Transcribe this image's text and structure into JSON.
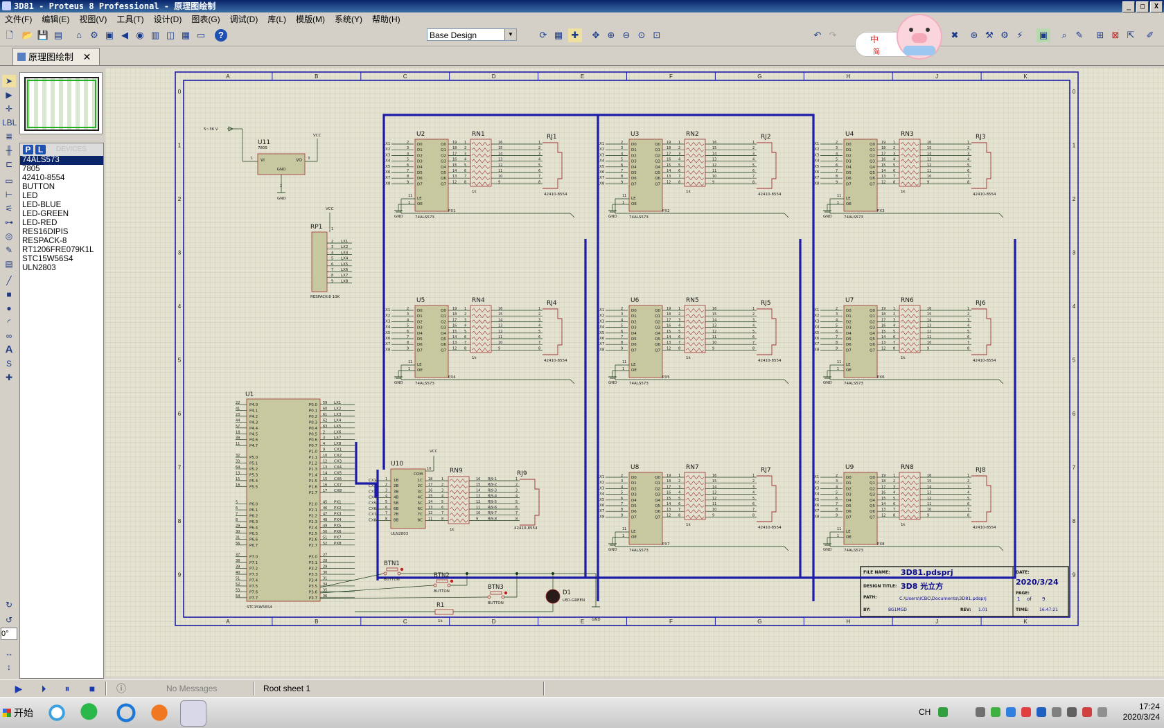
{
  "window": {
    "title": "3D81 - Proteus 8 Professional - 原理图绘制",
    "buttons": [
      "_",
      "□",
      "X"
    ]
  },
  "menu": [
    "文件(F)",
    "编辑(E)",
    "视图(V)",
    "工具(T)",
    "设计(D)",
    "图表(G)",
    "调试(D)",
    "库(L)",
    "模版(M)",
    "系统(Y)",
    "帮助(H)"
  ],
  "toolbar": {
    "design_select": "Base Design",
    "ime_zh": "中",
    "ime_jian": "简"
  },
  "tab": {
    "label": "原理图绘制",
    "close": "✕"
  },
  "device_panel": {
    "p_label": "P",
    "l_label": "L",
    "header": "DEVICES",
    "items": [
      "74ALS573",
      "7805",
      "42410-8554",
      "BUTTON",
      "LED",
      "LED-BLUE",
      "LED-GREEN",
      "LED-RED",
      "RES16DIPIS",
      "RESPACK-8",
      "RT1206FRE079K1L",
      "STC15W56S4",
      "ULN2803"
    ],
    "selected_index": 0
  },
  "rotation": "0°",
  "status": {
    "messages": "No Messages",
    "sheet": "Root sheet 1"
  },
  "sheet": {
    "cols": [
      "A",
      "B",
      "C",
      "D",
      "E",
      "F",
      "G",
      "H",
      "J",
      "K"
    ],
    "rows": [
      "0",
      "1",
      "2",
      "3",
      "4",
      "5",
      "6",
      "7",
      "8",
      "9"
    ],
    "titleblock": {
      "file_label": "FILE NAME:",
      "file": "3D81.pdsprj",
      "date_label": "DATE:",
      "date": "2020/3/24",
      "design_label": "DESIGN TITLE:",
      "design": "3D8 光立方",
      "page_label": "PAGE:",
      "page": "1",
      "of": "of",
      "pages": "9",
      "path_label": "PATH:",
      "path": "C:\\Users\\ICBC\\Documents\\3D81.pdsprj",
      "by_label": "BY:",
      "by": "BG1MGD",
      "rev_label": "REV:",
      "rev": "1.01",
      "time_label": "TIME:",
      "time": "16:47:21"
    },
    "latch_pins_in": [
      "D0",
      "D1",
      "D2",
      "D3",
      "D4",
      "D5",
      "D6",
      "D7"
    ],
    "latch_pins_out": [
      "Q0",
      "Q1",
      "Q2",
      "Q3",
      "Q4",
      "Q5",
      "Q6",
      "Q7"
    ],
    "lx_labels": [
      "LX1",
      "LX2",
      "LX3",
      "LX4",
      "LX5",
      "LX6",
      "LX7",
      "LX8"
    ],
    "latch_pin_nums_in": [
      "2",
      "3",
      "4",
      "5",
      "6",
      "7",
      "8",
      "9"
    ],
    "latch_pin_nums_out": [
      "19",
      "18",
      "17",
      "16",
      "15",
      "14",
      "13",
      "12"
    ],
    "rn_in_nums": [
      "1",
      "2",
      "3",
      "4",
      "5",
      "6",
      "7",
      "8"
    ],
    "rn_out_nums": [
      "16",
      "15",
      "14",
      "13",
      "12",
      "11",
      "10",
      "9"
    ],
    "rj_nums": [
      "1",
      "2",
      "3",
      "4",
      "5",
      "6",
      "7",
      "8"
    ],
    "le_label": "LE",
    "oe_label": "OE",
    "gnd": "GND",
    "vcc": "VCC",
    "latch_part": "74ALS573",
    "rn_value": "1k",
    "rj_part": "42410-8554",
    "pin11": "11",
    "pin1": "1",
    "groups": [
      {
        "u": "U2",
        "rn": "RN1",
        "rj": "RJ1",
        "px": "PX1"
      },
      {
        "u": "U3",
        "rn": "RN2",
        "rj": "RJ2",
        "px": "PX2"
      },
      {
        "u": "U4",
        "rn": "RN3",
        "rj": "RJ3",
        "px": "PX3"
      },
      {
        "u": "U5",
        "rn": "RN4",
        "rj": "RJ4",
        "px": "PX4"
      },
      {
        "u": "U6",
        "rn": "RN5",
        "rj": "RJ5",
        "px": "PX5"
      },
      {
        "u": "U7",
        "rn": "RN6",
        "rj": "RJ6",
        "px": "PX6"
      },
      {
        "u": "U8",
        "rn": "RN7",
        "rj": "RJ7",
        "px": "PX7"
      },
      {
        "u": "U9",
        "rn": "RN8",
        "rj": "RJ8",
        "px": "PX8"
      }
    ],
    "u10": {
      "label": "U10",
      "part": "ULN2803",
      "com": "COM",
      "rn": "RN9",
      "rj": "RJ9",
      "vcc_pin": "10",
      "in_labels": [
        "CX1",
        "CX2",
        "CX3",
        "CX4",
        "CX5",
        "CX6",
        "CX7",
        "CX8"
      ],
      "in_pins": [
        "1B",
        "2B",
        "3B",
        "4B",
        "5B",
        "6B",
        "7B",
        "8B"
      ],
      "out_pins": [
        "1C",
        "2C",
        "3C",
        "4C",
        "5C",
        "6C",
        "7C",
        "8C"
      ],
      "in_nums": [
        "1",
        "2",
        "3",
        "4",
        "5",
        "6",
        "7",
        "8"
      ],
      "out_nums": [
        "18",
        "17",
        "16",
        "15",
        "14",
        "13",
        "12",
        "11"
      ],
      "rj_nets": [
        "RJ9-1",
        "RJ9-2",
        "RJ9-3",
        "RJ9-4",
        "RJ9-5",
        "RJ9-6",
        "RJ9-7",
        "RJ9-8"
      ]
    },
    "u11": {
      "label": "U11",
      "part": "7805",
      "vi": "VI",
      "vo": "VO",
      "gnd": "GND",
      "supply": "5~36 V",
      "p1": "1",
      "p2": "2",
      "p3": "3"
    },
    "rp1": {
      "label": "RP1",
      "part": "RESPACK-8 10K",
      "pins": [
        "2",
        "3",
        "4",
        "5",
        "6",
        "7",
        "8",
        "9"
      ]
    },
    "u1": {
      "label": "U1",
      "part": "STC15W56S4",
      "left_pins": [
        "P4.0",
        "P4.1",
        "P4.2",
        "P4.3",
        "P4.4",
        "P4.5",
        "P4.6",
        "P4.7",
        "",
        "P5.0",
        "P5.1",
        "P5.2",
        "P5.3",
        "P5.4",
        "P5.5",
        "",
        "",
        "P6.0",
        "P6.1",
        "P6.2",
        "P6.3",
        "P6.4",
        "P6.5",
        "P6.6",
        "P6.7",
        "",
        "P7.0",
        "P7.1",
        "P7.2",
        "P7.3",
        "P7.4",
        "P7.5",
        "P7.6",
        "P7.7"
      ],
      "left_nums": [
        "22",
        "41",
        "23",
        "44",
        "57",
        "18",
        "39",
        "11",
        "",
        "32",
        "33",
        "64",
        "13",
        "15",
        "16",
        "",
        "",
        "5",
        "6",
        "7",
        "8",
        "29",
        "30",
        "31",
        "56",
        "",
        "37",
        "38",
        "39",
        "40",
        "51",
        "52",
        "53",
        "54"
      ],
      "right_pins": [
        "P0.0",
        "P0.1",
        "P0.2",
        "P0.3",
        "P0.4",
        "P0.5",
        "P0.6",
        "P0.7",
        "P1.0",
        "P1.1",
        "P1.2",
        "P1.3",
        "P1.4",
        "P1.5",
        "P1.6",
        "P1.7",
        "",
        "P2.0",
        "P2.1",
        "P2.2",
        "P2.3",
        "P2.4",
        "P2.5",
        "P2.6",
        "P2.7",
        "",
        "P3.0",
        "P3.1",
        "P3.2",
        "P3.3",
        "P3.4",
        "P3.5",
        "P3.6",
        "P3.7"
      ],
      "right_nums": [
        "59",
        "60",
        "61",
        "62",
        "63",
        "2",
        "3",
        "4",
        "9",
        "10",
        "12",
        "13",
        "14",
        "15",
        "16",
        "17",
        "",
        "45",
        "46",
        "47",
        "48",
        "49",
        "50",
        "51",
        "52",
        "",
        "27",
        "28",
        "29",
        "30",
        "31",
        "34",
        "35",
        "36"
      ],
      "right_nets": [
        "LX1",
        "LX2",
        "LX3",
        "LX4",
        "LX5",
        "LX6",
        "LX7",
        "LX8",
        "CX1",
        "CX2",
        "CX3",
        "CX4",
        "CX5",
        "CX6",
        "CX7",
        "CX8",
        "",
        "PX1",
        "PX2",
        "PX3",
        "PX4",
        "PX5",
        "PX6",
        "PX7",
        "PX8",
        "",
        "",
        "",
        "",
        "",
        "",
        "",
        "",
        ""
      ]
    },
    "buttons": [
      {
        "label": "BTN1",
        "part": "BUTTON"
      },
      {
        "label": "BTN2",
        "part": "BUTTON"
      },
      {
        "label": "BTN3",
        "part": "BUTTON"
      }
    ],
    "r1": {
      "label": "R1",
      "value": "1k"
    },
    "d1": {
      "label": "D1",
      "part": "LED-GREEN"
    }
  },
  "taskbar": {
    "start": "开始",
    "ime": "CH",
    "time": "17:24",
    "date": "2020/3/24"
  },
  "colors": {
    "accent": "#0a246a",
    "wire": "#1c1ca8",
    "component": "#c8c8a0",
    "component_border": "#a03030",
    "grid_bg": "#e4e2d0"
  }
}
